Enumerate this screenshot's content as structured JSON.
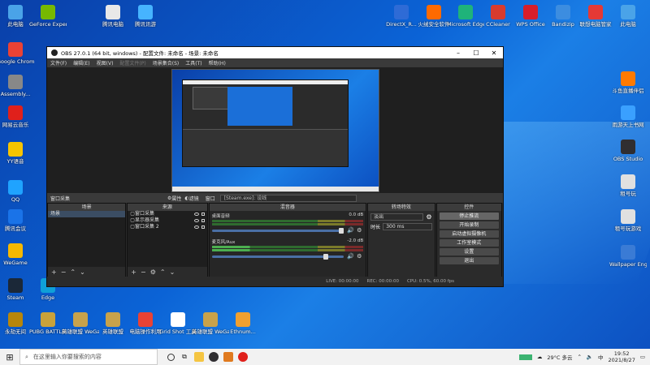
{
  "desktop_icons_left": [
    {
      "label": "此电脑",
      "color": "#4aa3e8"
    },
    {
      "label": "GeForce Experience",
      "color": "#76b900"
    },
    {
      "label": "腾讯电脑",
      "color": "#e8e8e8"
    },
    {
      "label": "腾讯讯游",
      "color": "#46b4ff"
    },
    {
      "label": "Google Chrome",
      "color": "#e94235"
    },
    {
      "label": "Assembly...",
      "color": "#888888"
    },
    {
      "label": "网易云音乐",
      "color": "#e0201b"
    },
    {
      "label": "YY语音",
      "color": "#f6c400"
    },
    {
      "label": "QQ",
      "color": "#1fa3ff"
    },
    {
      "label": "腾讯会议",
      "color": "#1a73e8"
    },
    {
      "label": "WeGame",
      "color": "#f5b800"
    },
    {
      "label": "Steam",
      "color": "#1b2838"
    },
    {
      "label": "Edge",
      "color": "#0fa0d8"
    }
  ],
  "desktop_icons_top_right": [
    {
      "label": "DirectX_R...",
      "color": "#2e6bd6"
    },
    {
      "label": "火绒安全软件",
      "color": "#ff6a00"
    },
    {
      "label": "Microsoft Edge",
      "color": "#1fb37a"
    },
    {
      "label": "CCleaner",
      "color": "#d83b2e"
    },
    {
      "label": "WPS Office",
      "color": "#d81e2a"
    },
    {
      "label": "Bandizip",
      "color": "#3c8de0"
    },
    {
      "label": "联想电脑管家",
      "color": "#e53935"
    },
    {
      "label": "此电脑",
      "color": "#4aa3e8"
    }
  ],
  "desktop_icons_right": [
    {
      "label": "斗鱼直播伴侣",
      "color": "#ff7a00"
    },
    {
      "label": "雨游天上书网",
      "color": "#3aa0ff"
    },
    {
      "label": "OBS Studio",
      "color": "#302e31"
    },
    {
      "label": "租号玩",
      "color": "#e0e0e0"
    },
    {
      "label": "租号玩游戏",
      "color": "#e0e0e0"
    },
    {
      "label": "Wallpaper Engine...",
      "color": "#3a7bd5"
    }
  ],
  "desktop_icons_bottom": [
    {
      "label": "永劫无间",
      "color": "#b8860b"
    },
    {
      "label": "PUBG BATTLEGR...",
      "color": "#c9a23a"
    },
    {
      "label": "英雄联盟 WeGame版",
      "color": "#c8a24a"
    },
    {
      "label": "英雄联盟",
      "color": "#c8a24a"
    },
    {
      "label": "电脑操作利用",
      "color": "#e94235"
    },
    {
      "label": "Grid Shot 工具",
      "color": "#ffffff"
    },
    {
      "label": "英雄联盟 WeGame版",
      "color": "#c8a24a"
    },
    {
      "label": "Ethnum...",
      "color": "#f0a030"
    }
  ],
  "obs": {
    "title": "OBS 27.0.1 (64 bit, windows) - 配置文件: 未命名 - 场景: 未命名",
    "menu": [
      "文件(F)",
      "编辑(E)",
      "视图(V)",
      "配置文件(P)",
      "场景集合(S)",
      "工具(T)",
      "帮助(H)"
    ],
    "source_bar": {
      "source_name": "窗口采集",
      "properties": "属性",
      "filters": "滤镜",
      "window_label": "窗口",
      "window_value": "[Steam.exe]: 设线"
    },
    "docks": {
      "scenes_title": "场景",
      "scenes": [
        "场景"
      ],
      "sources_title": "来源",
      "sources": [
        "窗口采集",
        "显示器采集",
        "窗口采集 2"
      ],
      "mixer_title": "混音器",
      "mixer": [
        {
          "name": "桌面音频",
          "db": "0.0 dB"
        },
        {
          "name": "麦克风/Aux",
          "db": "-2.0 dB"
        }
      ],
      "transitions_title": "转场特效",
      "transition_value": "淡出",
      "duration_label": "时长",
      "duration_value": "300 ms",
      "controls_title": "控件",
      "controls": [
        "停止推流",
        "开始录制",
        "启动虚拟摄像机",
        "工作室模式",
        "设置",
        "退出"
      ]
    },
    "status": {
      "live": "LIVE: 00:00:00",
      "rec": "REC: 00:00:00",
      "cpu": "CPU: 0.5%, 60.00 fps"
    }
  },
  "taskbar": {
    "search_placeholder": "在这里输入你要搜索的内容",
    "weather": "29°C 多云",
    "ime": "中",
    "time": "19:52",
    "date": "2021/8/27"
  }
}
